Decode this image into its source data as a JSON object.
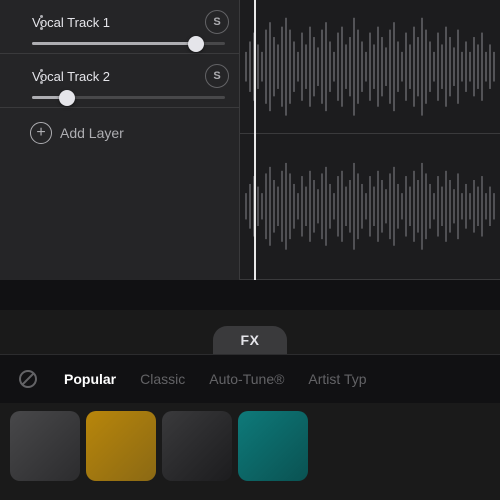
{
  "tracks": [
    {
      "id": "track1",
      "name": "Vocal Track 1",
      "solo_label": "S",
      "slider_fill_pct": 85
    },
    {
      "id": "track2",
      "name": "Vocal Track 2",
      "solo_label": "S",
      "slider_fill_pct": 18
    }
  ],
  "add_layer": {
    "label": "Add Layer"
  },
  "fx_button": {
    "label": "FX"
  },
  "tabs": [
    {
      "id": "popular",
      "label": "Popular",
      "active": true
    },
    {
      "id": "classic",
      "label": "Classic",
      "active": false
    },
    {
      "id": "autotune",
      "label": "Auto-Tune®",
      "active": false
    },
    {
      "id": "artisttyp",
      "label": "Artist Typ",
      "active": false
    }
  ],
  "no_fx_icon": "⊘",
  "thumbnails": [
    {
      "id": "thumb1",
      "color_class": "thumb-grey"
    },
    {
      "id": "thumb2",
      "color_class": "thumb-gold"
    },
    {
      "id": "thumb3",
      "color_class": "thumb-dark"
    },
    {
      "id": "thumb4",
      "color_class": "thumb-teal"
    }
  ]
}
